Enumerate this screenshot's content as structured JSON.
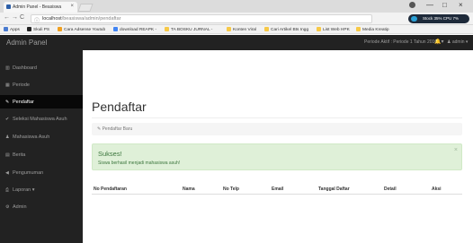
{
  "browser": {
    "tab_title": "Admin Panel - Beasiswa",
    "tab_close": "×",
    "url_host": "localhost",
    "url_path": "/beasiswa/admin/pendaftar",
    "extension_text": "Stock 35%  CPU 7%",
    "window_controls": [
      "—",
      "□",
      "×"
    ],
    "bookmarks": [
      {
        "label": "Apps",
        "color": "#4a7bd0"
      },
      {
        "label": "Skuli PS",
        "color": "#222222"
      },
      {
        "label": "Cara Adsense Youtub",
        "color": "#f0a020"
      },
      {
        "label": "download REAPK -",
        "color": "#4285f4"
      },
      {
        "label": "TA BOSKU JURNAL -",
        "color": "#f7c948"
      },
      {
        "label": "Konten Viral",
        "color": "#f7c948"
      },
      {
        "label": "Cari Artikel Bts Ingg",
        "color": "#f7c948"
      },
      {
        "label": "List Web HPK",
        "color": "#f7c948"
      },
      {
        "label": "Media Kreatip",
        "color": "#f7c948"
      }
    ]
  },
  "navbar": {
    "brand": "Admin Panel",
    "period": "Periode Aktif : Periode 1 Tahun 2016",
    "user": "admin"
  },
  "sidebar": {
    "items": [
      {
        "label": "Dashboard",
        "icon": "dashboard-icon",
        "glyph": "▥",
        "active": false
      },
      {
        "label": "Periode",
        "icon": "calendar-icon",
        "glyph": "▦",
        "active": false
      },
      {
        "label": "Pendaftar",
        "icon": "edit-icon",
        "glyph": "✎",
        "active": true
      },
      {
        "label": "Seleksi Mahasiswa Asuh",
        "icon": "check-icon",
        "glyph": "✔",
        "active": false
      },
      {
        "label": "Mahasiswa Asuh",
        "icon": "user-icon",
        "glyph": "♟",
        "active": false
      },
      {
        "label": "Berita",
        "icon": "news-icon",
        "glyph": "▤",
        "active": false
      },
      {
        "label": "Pengumuman",
        "icon": "megaphone-icon",
        "glyph": "◀",
        "active": false
      },
      {
        "label": "Laporan",
        "icon": "printer-icon",
        "glyph": "⎙",
        "active": false
      },
      {
        "label": "Admin",
        "icon": "gear-icon",
        "glyph": "⚙",
        "active": false
      }
    ]
  },
  "main": {
    "title": "Pendaftar",
    "breadcrumb": "Pendaftar Baru",
    "alert": {
      "title": "Sukses!",
      "message": "Siswa berhasil menjadi mahasiswa asuh!",
      "close": "×",
      "color": "#3c763d",
      "background": "#dff0d8"
    },
    "table": {
      "columns": [
        "No Pendaftaran",
        "Nama",
        "No Telp",
        "Email",
        "Tanggal Daftar",
        "Detail",
        "Aksi"
      ]
    }
  }
}
